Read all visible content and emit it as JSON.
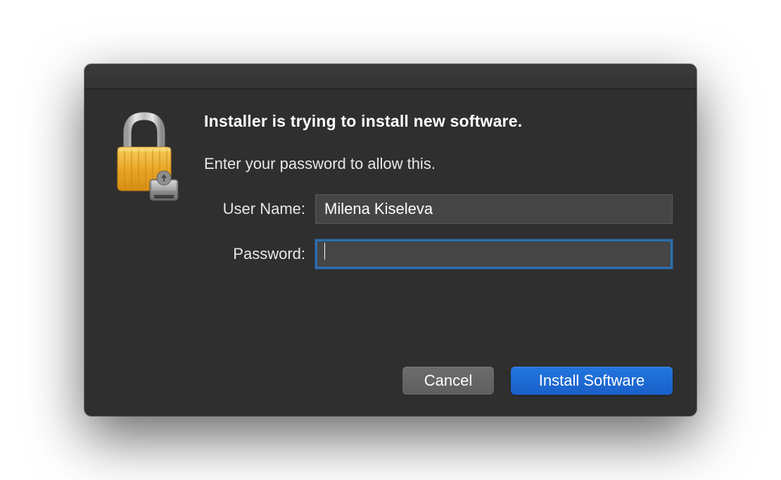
{
  "dialog": {
    "heading": "Installer is trying to install new software.",
    "instruction": "Enter your password to allow this.",
    "fields": {
      "username": {
        "label": "User Name:",
        "value": "Milena Kiseleva"
      },
      "password": {
        "label": "Password:",
        "value": ""
      }
    },
    "buttons": {
      "cancel": "Cancel",
      "confirm": "Install Software"
    }
  },
  "colors": {
    "accent": "#1f66d4",
    "focus_ring": "#2b6fb3",
    "window_bg": "#2f2f2f",
    "input_bg": "#454545"
  }
}
